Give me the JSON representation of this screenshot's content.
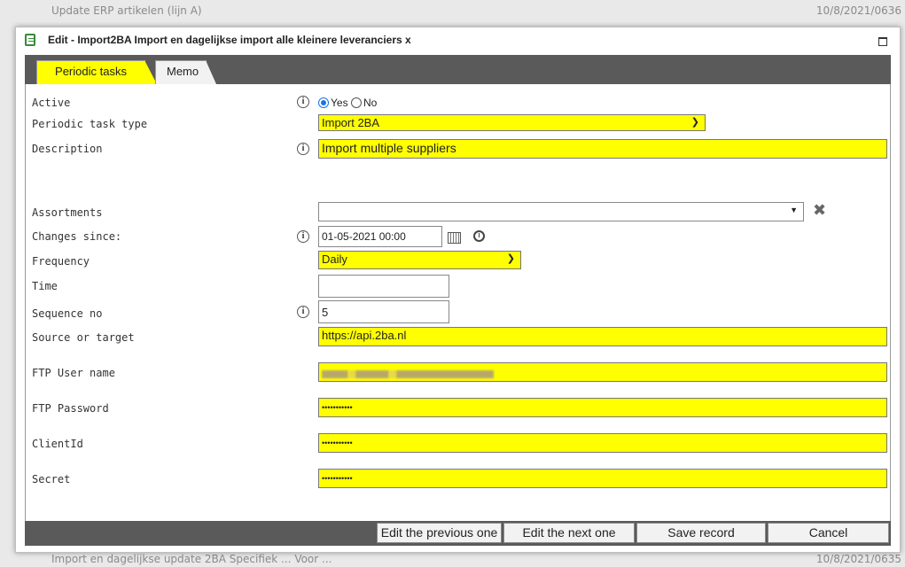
{
  "background": {
    "top_row": {
      "text": "Update ERP artikelen (lijn A)",
      "date": "10/8/2021/0636"
    },
    "bottom_row": {
      "text": "Import en dagelijkse update 2BA Specifiek ... Voor ...",
      "date": "10/8/2021/0635"
    }
  },
  "dialog": {
    "title": "Edit - Import2BA Import en dagelijkse import alle kleinere leveranciers x",
    "tabs": [
      "Periodic tasks",
      "Memo"
    ]
  },
  "form": {
    "active": {
      "label": "Active",
      "yes": "Yes",
      "no": "No",
      "selected": "Yes"
    },
    "task_type": {
      "label": "Periodic task type",
      "value": "Import 2BA"
    },
    "description": {
      "label": "Description",
      "value": "Import multiple suppliers"
    },
    "assortments": {
      "label": "Assortments",
      "value": ""
    },
    "changes_since": {
      "label": "Changes since:",
      "value": "01-05-2021 00:00"
    },
    "frequency": {
      "label": "Frequency",
      "value": "Daily"
    },
    "time": {
      "label": "Time",
      "value": ""
    },
    "sequence": {
      "label": "Sequence no",
      "value": "5"
    },
    "source": {
      "label": "Source or target",
      "value": "https://api.2ba.nl"
    },
    "ftp_user": {
      "label": "FTP User name"
    },
    "ftp_password": {
      "label": "FTP Password",
      "value": "•••••••••••"
    },
    "client_id": {
      "label": "ClientId",
      "value": "•••••••••••"
    },
    "secret": {
      "label": "Secret",
      "value": "•••••••••••"
    }
  },
  "footer": {
    "prev": "Edit the previous one",
    "next": "Edit the next one",
    "save": "Save record",
    "cancel": "Cancel"
  },
  "colors": {
    "highlight": "#ffff00",
    "bar": "#5a5a5a"
  }
}
